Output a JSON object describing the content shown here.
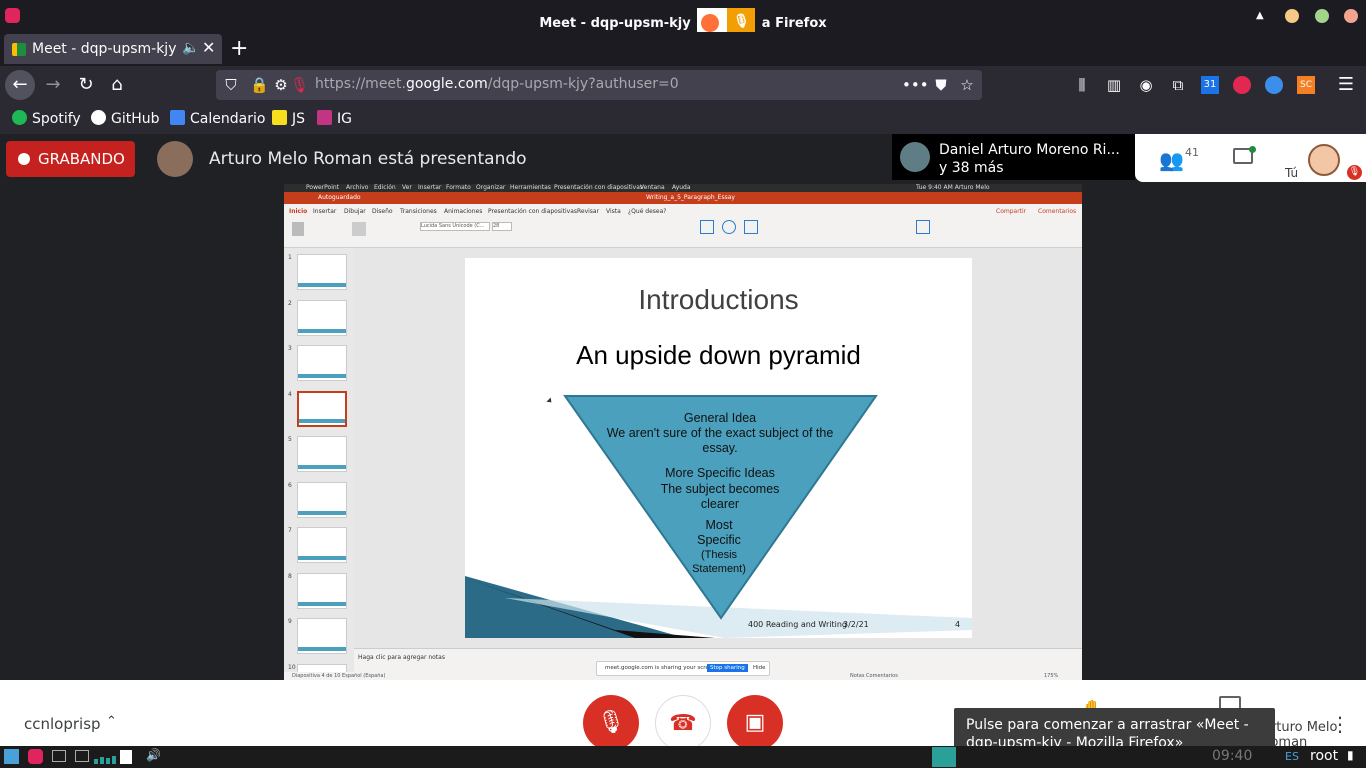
{
  "window": {
    "title_left": "Meet - dqp-upsm-kjy",
    "title_right": "a Firefox"
  },
  "tab": {
    "label": "Meet - dqp-upsm-kjy",
    "new_tab": "+"
  },
  "address": {
    "url_prefix": "https://meet.",
    "url_domain": "google.com",
    "url_path": "/dqp-upsm-kjy?authuser=0",
    "more": "•••"
  },
  "bookmarks": [
    {
      "label": "Spotify",
      "color": "#1db954"
    },
    {
      "label": "GitHub",
      "color": "#ffffff"
    },
    {
      "label": "Calendario",
      "color": "#4285f4"
    },
    {
      "label": "JS",
      "color": "#f7df1e"
    },
    {
      "label": "IG",
      "color": "#c13584"
    }
  ],
  "meet": {
    "recording_label": "GRABANDO",
    "presenter_text": "Arturo Melo Roman está presentando",
    "participant_name": "Daniel Arturo Moreno Ri...",
    "participant_more": "y 38 más",
    "people_count": "41",
    "self_label": "Tú",
    "meeting_code": "ccnloprisp",
    "tooltip": "Pulse para comenzar a arrastrar «Meet - dqp-upsm-kjy - Mozilla Firefox»",
    "presenting_label": "Arturo Melo Roman"
  },
  "powerpoint": {
    "menu": [
      "PowerPoint",
      "Archivo",
      "Edición",
      "Ver",
      "Insertar",
      "Formato",
      "Organizar",
      "Herramientas",
      "Presentación con diapositivas",
      "Ventana",
      "Ayuda"
    ],
    "menu_right": "Tue 9:40 AM   Arturo Melo",
    "doc_title": "Writing_a_5_Paragraph_Essay",
    "autosave": "Autoguardado",
    "tabs": [
      "Inicio",
      "Insertar",
      "Dibujar",
      "Diseño",
      "Transiciones",
      "Animaciones",
      "Presentación con diapositivas",
      "Revisar",
      "Vista",
      "¿Qué desea?"
    ],
    "share": "Compartir",
    "comments": "Comentarios",
    "font_name": "Lucida Sans Unicode (C...",
    "font_size": "28",
    "notes_placeholder": "Haga clic para agregar notas",
    "status_left": "Diapositiva 4 de 10    Español (España)",
    "status_right": "Notas   Comentarios",
    "zoom": "175%",
    "sharing_text": "meet.google.com is sharing your screen.",
    "stop_sharing": "Stop sharing",
    "hide": "Hide"
  },
  "slide": {
    "title": "Introductions",
    "subtitle": "An upside down pyramid",
    "general_idea": "General Idea",
    "general_body": "We aren't sure of the exact subject of the essay.",
    "specific_ideas": "More Specific Ideas",
    "specific_body": "The subject becomes clearer",
    "most_specific": "Most Specific",
    "thesis": "(Thesis Statement)",
    "footer_left": "400 Reading and Writing",
    "footer_date": "3/2/21",
    "footer_page": "4",
    "pyramid_color": "#4aa0bd"
  },
  "thumbnails": [
    "1",
    "2",
    "3",
    "4",
    "5",
    "6",
    "7",
    "8",
    "9",
    "10"
  ],
  "taskbar": {
    "lang": "ES",
    "user": "root",
    "time": "09:40"
  }
}
